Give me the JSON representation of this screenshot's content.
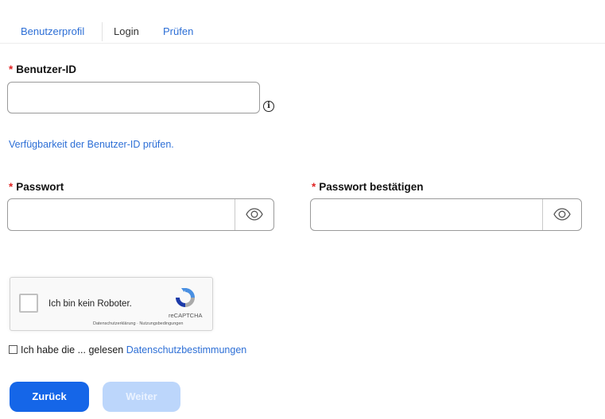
{
  "tabs": [
    {
      "label": "Benutzerprofil",
      "active": false
    },
    {
      "label": "Login",
      "active": true
    },
    {
      "label": "Prüfen",
      "active": false
    }
  ],
  "form": {
    "required_marker": "*",
    "user_id": {
      "label": "Benutzer-ID",
      "value": "",
      "info_icon": "info-icon"
    },
    "check_availability_link": "Verfügbarkeit der Benutzer-ID prüfen.",
    "password": {
      "label": "Passwort",
      "value": "",
      "toggle_icon": "eye-icon"
    },
    "password_confirm": {
      "label": "Passwort bestätigen",
      "value": "",
      "toggle_icon": "eye-icon"
    }
  },
  "captcha": {
    "label": "Ich bin kein Roboter.",
    "brand": "reCAPTCHA",
    "links": "Datenschutzerklärung · Nutzungsbedingungen",
    "checked": false
  },
  "consent": {
    "text": "Ich habe die ... gelesen",
    "link": "Datenschutzbestimmungen",
    "checked": false
  },
  "buttons": {
    "back": "Zurück",
    "next": "Weiter"
  },
  "colors": {
    "accent": "#1566e8",
    "link": "#2d6fd6",
    "required": "#e02424",
    "disabled_button": "#bcd6fb"
  }
}
